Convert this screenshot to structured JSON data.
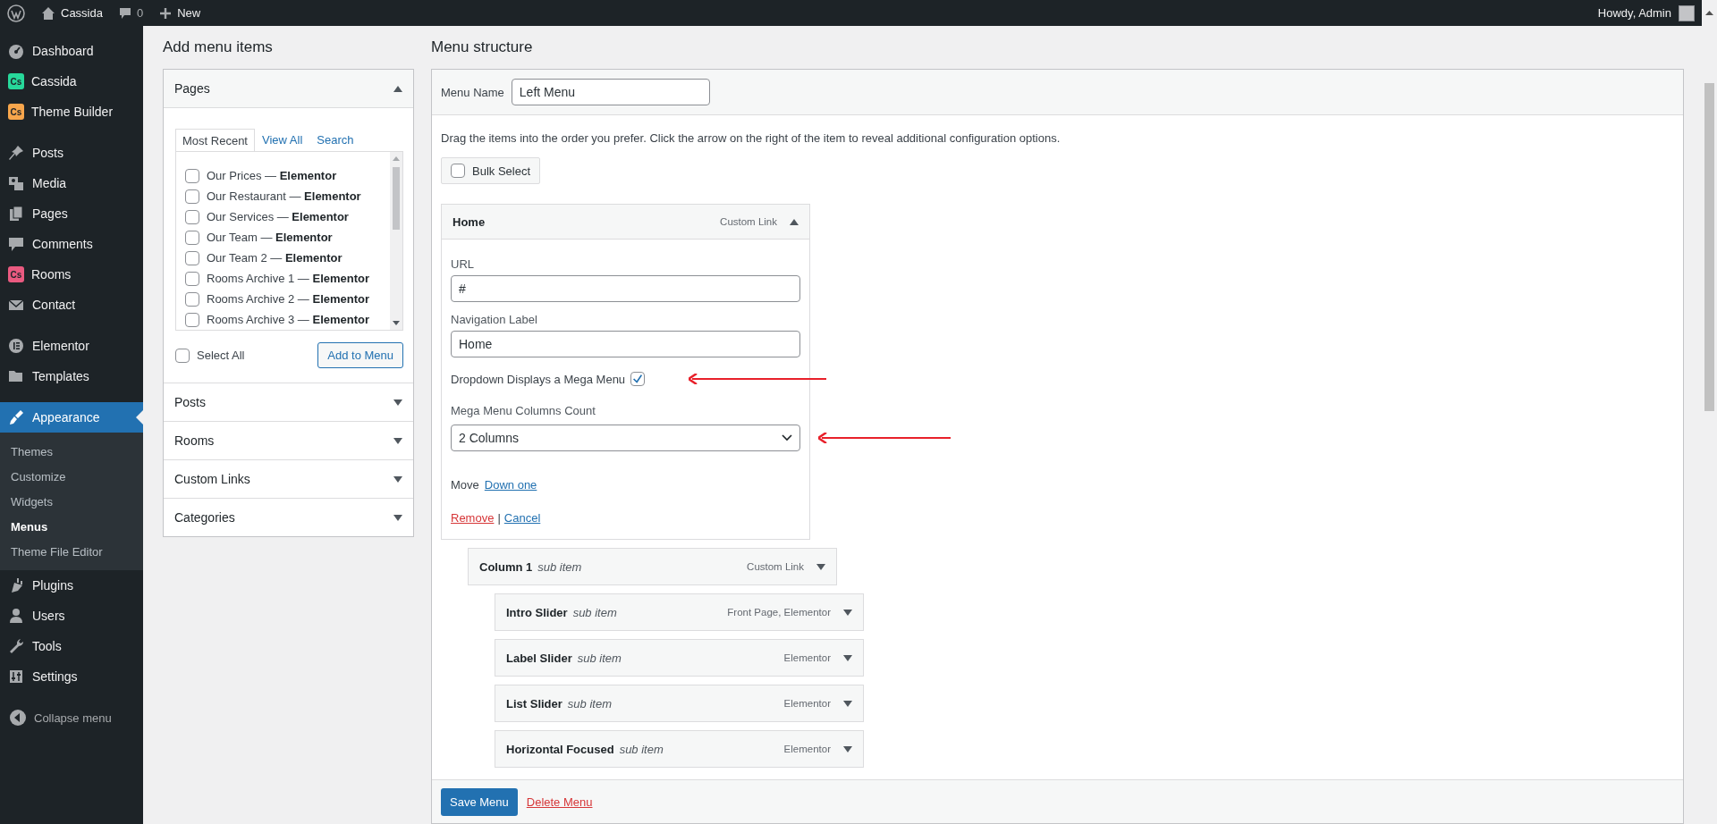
{
  "top_bar": {
    "site": "Cassida",
    "comments": "0",
    "new": "New",
    "greeting": "Howdy, Admin"
  },
  "sidebar": {
    "groups": [
      {
        "items": [
          {
            "label": "Dashboard",
            "kind": "dashboard",
            "selected": false
          },
          {
            "label": "Cassida",
            "kind": "badge",
            "badge": "Cs",
            "color": "#27d89a",
            "selected": false
          },
          {
            "label": "Theme Builder",
            "kind": "badge",
            "badge": "Cs",
            "color": "#f7a64c",
            "selected": false
          }
        ]
      },
      {
        "items": [
          {
            "label": "Posts",
            "kind": "pin",
            "selected": false
          },
          {
            "label": "Media",
            "kind": "media",
            "selected": false
          },
          {
            "label": "Pages",
            "kind": "pages",
            "selected": false
          },
          {
            "label": "Comments",
            "kind": "comment",
            "selected": false
          },
          {
            "label": "Rooms",
            "kind": "badge",
            "badge": "Cs",
            "color": "#ea5a80",
            "selected": false
          },
          {
            "label": "Contact",
            "kind": "mail",
            "selected": false
          }
        ]
      },
      {
        "items": [
          {
            "label": "Elementor",
            "kind": "elementor",
            "selected": false
          },
          {
            "label": "Templates",
            "kind": "folder",
            "selected": false
          }
        ]
      },
      {
        "items": [
          {
            "label": "Appearance",
            "kind": "brush",
            "selected": true,
            "children": [
              {
                "label": "Themes",
                "selected": false
              },
              {
                "label": "Customize",
                "selected": false
              },
              {
                "label": "Widgets",
                "selected": false
              },
              {
                "label": "Menus",
                "selected": true
              },
              {
                "label": "Theme File Editor",
                "selected": false
              }
            ]
          },
          {
            "label": "Plugins",
            "kind": "plug",
            "selected": false
          },
          {
            "label": "Users",
            "kind": "user",
            "selected": false
          },
          {
            "label": "Tools",
            "kind": "wrench",
            "selected": false
          },
          {
            "label": "Settings",
            "kind": "sliders",
            "selected": false
          }
        ]
      }
    ],
    "collapse": "Collapse menu"
  },
  "add_menu_items": {
    "title": "Add menu items",
    "sections": [
      {
        "title": "Pages",
        "expanded": true,
        "tabs": [
          {
            "label": "Most Recent",
            "selected": true
          },
          {
            "label": "View All",
            "selected": false
          },
          {
            "label": "Search",
            "selected": false
          }
        ],
        "items": [
          {
            "label": "Our Prices — **Elementor**",
            "checked": false
          },
          {
            "label": "Our Restaurant — **Elementor**",
            "checked": false
          },
          {
            "label": "Our Services — **Elementor**",
            "checked": false
          },
          {
            "label": "Our Team — **Elementor**",
            "checked": false
          },
          {
            "label": "Our Team 2 — **Elementor**",
            "checked": false
          },
          {
            "label": "Rooms Archive 1 — **Elementor**",
            "checked": false
          },
          {
            "label": "Rooms Archive 2 — **Elementor**",
            "checked": false
          },
          {
            "label": "Rooms Archive 3 — **Elementor**",
            "checked": false
          }
        ],
        "select_all": {
          "label": "Select All",
          "checked": false
        },
        "button": "Add to Menu"
      },
      {
        "title": "Posts",
        "expanded": false
      },
      {
        "title": "Rooms",
        "expanded": false
      },
      {
        "title": "Custom Links",
        "expanded": false
      },
      {
        "title": "Categories",
        "expanded": false
      }
    ]
  },
  "menu_structure": {
    "title": "Menu structure",
    "menu_name_label": "Menu Name",
    "menu_name": "Left Menu",
    "instructions": "Drag the items into the order you prefer. Click the arrow on the right of the item to reveal additional configuration options.",
    "bulk_select": {
      "label": "Bulk Select",
      "checked": false
    },
    "items": [
      {
        "title": "Home",
        "type": "Custom Link",
        "expanded": true,
        "settings": {
          "url_label": "URL",
          "url": "#",
          "nav_label_label": "Navigation Label",
          "nav_label": "Home",
          "mega_label": "Dropdown Displays a Mega Menu",
          "mega_checked": true,
          "columns_label": "Mega Menu Columns Count",
          "columns_value": "2 Columns",
          "move_label": "Move",
          "move_link": "Down one",
          "remove": "Remove",
          "separator": "|",
          "cancel": "Cancel"
        },
        "children": [
          {
            "title": "Column 1",
            "subtitle": "sub item",
            "type": "Custom Link",
            "expanded": false,
            "children": [
              {
                "title": "Intro Slider",
                "subtitle": "sub item",
                "type": "Front Page, Elementor",
                "expanded": false
              },
              {
                "title": "Label Slider",
                "subtitle": "sub item",
                "type": "Elementor",
                "expanded": false
              },
              {
                "title": "List Slider",
                "subtitle": "sub item",
                "type": "Elementor",
                "expanded": false
              },
              {
                "title": "Horizontal Focused",
                "subtitle": "sub item",
                "type": "Elementor",
                "expanded": false
              }
            ]
          }
        ]
      }
    ],
    "save": "Save Menu",
    "delete": "Delete Menu"
  }
}
